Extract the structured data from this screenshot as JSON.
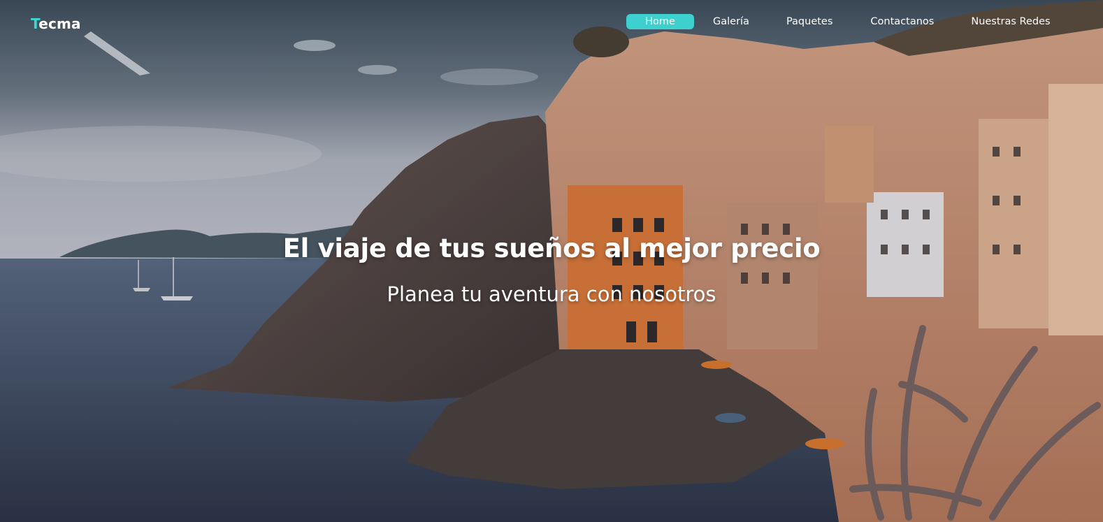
{
  "brand": {
    "accent_letter": "T",
    "rest": "ecma",
    "accent_color": "#3dd6d0"
  },
  "nav": {
    "items": [
      {
        "label": "Home",
        "active": true
      },
      {
        "label": "Galería",
        "active": false
      },
      {
        "label": "Paquetes",
        "active": false
      },
      {
        "label": "Contactanos",
        "active": false
      },
      {
        "label": "Nuestras Redes",
        "active": false
      }
    ],
    "active_color": "#3ecfcf"
  },
  "hero": {
    "title": "El viaje de tus sueños al mejor precio",
    "subtitle": "Planea tu aventura con nosotros",
    "background_description": "coastal-cliff-village-photo"
  }
}
